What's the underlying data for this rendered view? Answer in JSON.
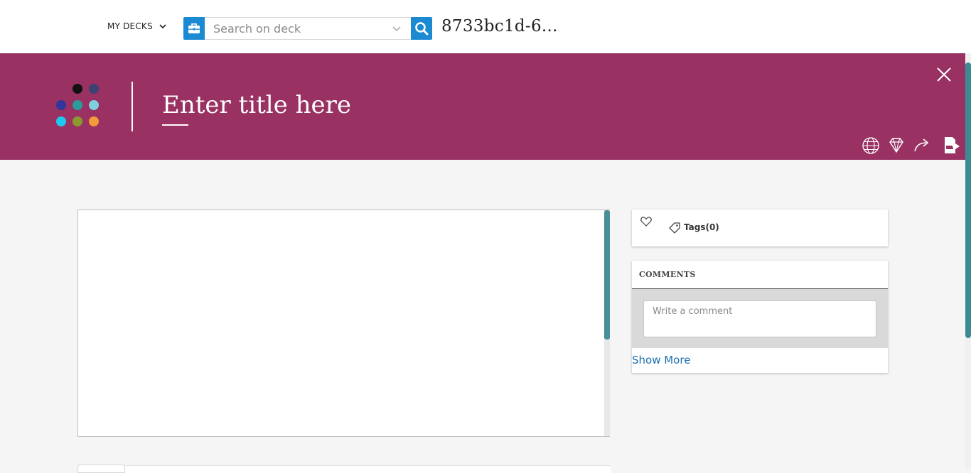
{
  "header": {
    "my_decks_label": "MY DECKS",
    "search_placeholder": "Search on deck",
    "search_value": "",
    "deck_id": "8733bc1d-6..."
  },
  "banner": {
    "background": "#993262",
    "title_placeholder": "Enter title here",
    "logo_dot_colors": [
      "#111111",
      "#3c4272",
      "#31359c",
      "#2a9d9b",
      "#7fd0df",
      "#1ec8f0",
      "#8b9a2c",
      "#f59a3a"
    ],
    "tools": [
      "wireframe-globe-icon",
      "diamond-icon",
      "share-arrow-icon",
      "export-pdf-icon"
    ]
  },
  "meta": {
    "tags_label": "Tags(0)"
  },
  "comments": {
    "title": "COMMENTS",
    "input_placeholder": "Write a comment",
    "show_more_label": "Show More"
  },
  "colors": {
    "accent_blue": "#1b8ad3",
    "scroll_teal": "#3c8a93",
    "link_blue": "#1a6fb0"
  }
}
